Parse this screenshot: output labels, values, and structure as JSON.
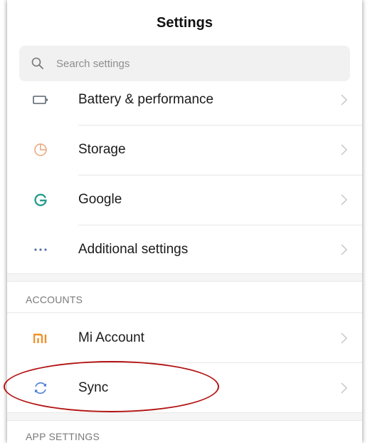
{
  "header": {
    "title": "Settings"
  },
  "search": {
    "placeholder": "Search settings"
  },
  "items": [
    {
      "label": "Battery & performance",
      "icon": "battery-icon"
    },
    {
      "label": "Storage",
      "icon": "storage-pie-icon"
    },
    {
      "label": "Google",
      "icon": "google-g-icon"
    },
    {
      "label": "Additional settings",
      "icon": "more-dots-icon"
    }
  ],
  "sections": {
    "accounts": "ACCOUNTS",
    "app_settings": "APP SETTINGS"
  },
  "accounts": [
    {
      "label": "Mi Account",
      "icon": "mi-logo-icon"
    },
    {
      "label": "Sync",
      "icon": "sync-icon"
    }
  ],
  "colors": {
    "battery": "#5b6570",
    "storage": "#e9a57a",
    "google": "#2a9d8f",
    "dots": "#5b6fa8",
    "mi": "#f0902a",
    "sync": "#4f7fd8",
    "highlight": "#b31313"
  }
}
